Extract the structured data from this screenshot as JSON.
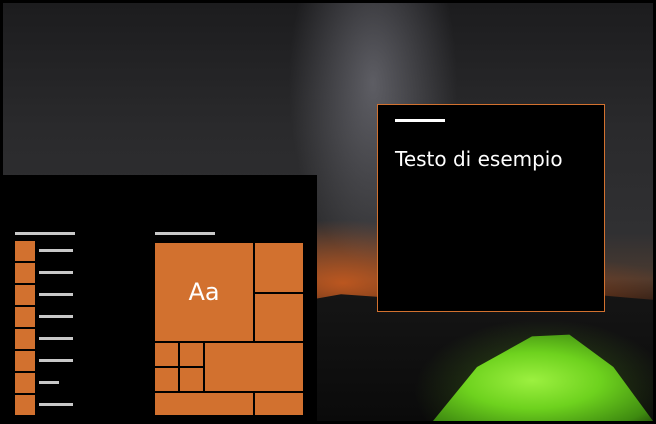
{
  "sample_window": {
    "text": "Testo di esempio"
  },
  "start_menu": {
    "tile_label": "Aa"
  },
  "accent_color": "#d2712f",
  "wallpaper_description_icons": [
    "tent-icon"
  ]
}
